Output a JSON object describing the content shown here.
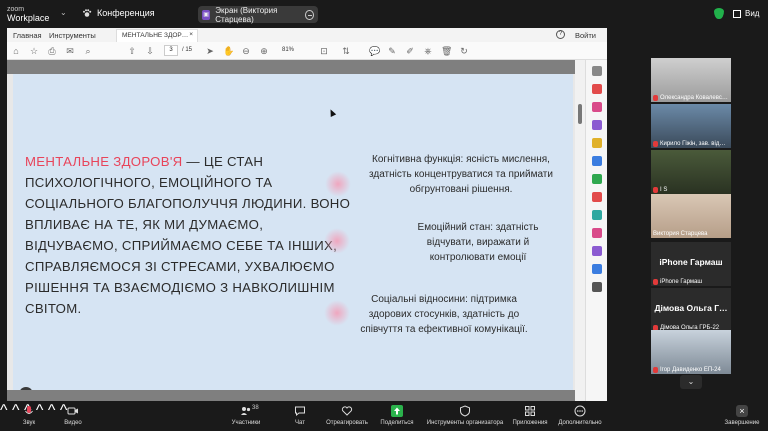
{
  "app": {
    "logo_line1": "zoom",
    "logo_line2": "Workplace",
    "meeting_label": "Конференция"
  },
  "screen_share": {
    "label": "Экран (Виктория Старцева)"
  },
  "view": {
    "label": "Вид"
  },
  "viewer": {
    "menu": {
      "home": "Главная",
      "tools": "Инструменты",
      "tab_title": "МЕНТАЛЬНЕ ЗДОР…",
      "sign_in": "Войти"
    },
    "page_current": "3",
    "page_total": "/ 15",
    "zoom": "81%"
  },
  "slide": {
    "main_red": "МЕНТАЛЬНЕ ЗДОРОВ'Я",
    "main_rest": " — ЦЕ СТАН ПСИХОЛОГІЧНОГО, ЕМОЦІЙНОГО ТА СОЦІАЛЬНОГО БЛАГОПОЛУЧЧЯ ЛЮДИНИ. ВОНО ВПЛИВАЄ НА ТЕ, ЯК МИ ДУМАЄМО, ВІДЧУВАЄМО, СПРИЙМАЄМО СЕБЕ ТА ІНШИХ, СПРАВЛЯЄМОСЯ ЗІ СТРЕСАМИ, УХВАЛЮЄМО РІШЕННЯ ТА ВЗАЄМОДІЄМО З НАВКОЛИШНІМ СВІТОМ.",
    "note_cognitive": "Когнітивна функція: ясність мислення, здатність концентруватися та приймати обгрунтовані рішення.",
    "note_emotional": "Емоційний стан: здатність відчувати, виражати й контролювати емоції",
    "note_social": "Соціальні відносини: підтримка здорових стосунків, здатність до співчуття та ефективної комунікації."
  },
  "participants": [
    {
      "name": "Олександра Ковалевс…"
    },
    {
      "name": "Кирило Гіжін, зав. від…"
    },
    {
      "name": "I S"
    },
    {
      "name": "Виктория Старцева"
    },
    {
      "big": "iPhone Гармаш",
      "name": "iPhone Гармаш"
    },
    {
      "big": "Дімова Ольга Г…",
      "name": "Дімова Ольга ГРБ-22"
    },
    {
      "name": "Ігор Давиденко ЕП-24"
    }
  ],
  "controls": {
    "audio": "Звук",
    "video": "Видео",
    "participants": "Участники",
    "participants_count": "38",
    "chat": "Чат",
    "react": "Отреагировать",
    "share": "Поделиться",
    "host_tools": "Инструменты организатора",
    "apps": "Приложения",
    "more": "Дополнительно",
    "end": "Завершение"
  },
  "colors": {
    "accent_red": "#e8445a",
    "slide_bg": "#d6e4f3",
    "share_green": "#2bb24c",
    "active_outline": "#21b14b"
  }
}
